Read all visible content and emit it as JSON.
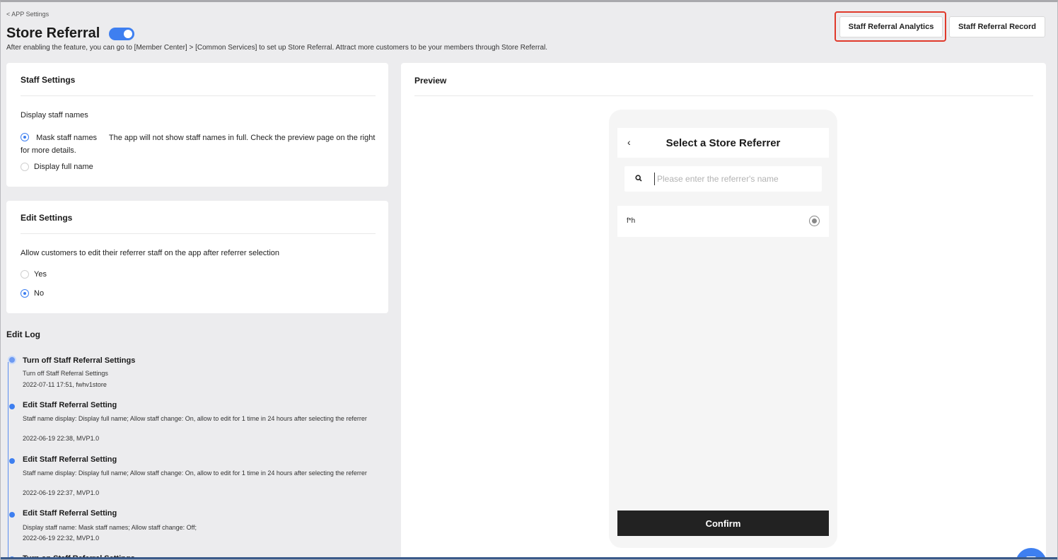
{
  "header": {
    "back_label": "< APP Settings",
    "title": "Store Referral",
    "toggle_on": true,
    "subtitle": "After enabling the feature, you can go to [Member Center] > [Common Services] to set up Store Referral. Attract more customers to be your members through Store Referral.",
    "analytics_button": "Staff Referral Analytics",
    "record_button": "Staff Referral Record"
  },
  "staff_settings": {
    "title": "Staff Settings",
    "display_label": "Display staff names",
    "mask_option": "Mask staff names",
    "mask_description": "The app will not show staff names in full. Check the preview page on the right for more details.",
    "full_option": "Display full name",
    "selected": "mask"
  },
  "edit_settings": {
    "title": "Edit Settings",
    "allow_label": "Allow customers to edit their referrer staff on the app after referrer selection",
    "yes_option": "Yes",
    "no_option": "No",
    "selected": "no"
  },
  "edit_log": {
    "heading": "Edit Log",
    "entries": [
      {
        "title": "Turn off Staff Referral Settings",
        "desc": "Turn off Staff Referral Settings",
        "meta": "2022-07-11 17:51, fwhv1store"
      },
      {
        "title": "Edit Staff Referral Setting",
        "desc": "Staff name display: Display full name; Allow staff change: On, allow to edit for 1 time in 24 hours after selecting the referrer",
        "meta": "2022-06-19 22:38, MVP1.0"
      },
      {
        "title": "Edit Staff Referral Setting",
        "desc": "Staff name display: Display full name; Allow staff change: On, allow to edit for 1 time in 24 hours after selecting the referrer",
        "meta": "2022-06-19 22:37, MVP1.0"
      },
      {
        "title": "Edit Staff Referral Setting",
        "desc": "Display staff name: Mask staff names; Allow staff change: Off;",
        "meta": "2022-06-19 22:32, MVP1.0"
      },
      {
        "title": "Turn on Staff Referral Settings",
        "desc": "",
        "meta": ""
      }
    ]
  },
  "preview": {
    "title": "Preview",
    "phone_title": "Select a Store Referrer",
    "back_glyph": "‹",
    "search_placeholder": "Please enter the referrer's name",
    "item_name": "f*h",
    "confirm": "Confirm"
  },
  "colors": {
    "accent": "#3e7ff0",
    "highlight": "#e0392b",
    "background": "#ececee"
  }
}
